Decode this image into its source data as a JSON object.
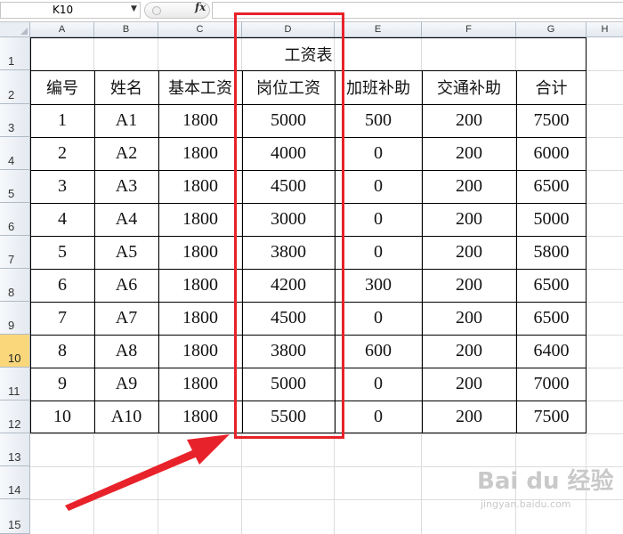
{
  "formula_bar": {
    "name_box": "K10",
    "fx_label": "fx",
    "formula": ""
  },
  "columns": [
    "A",
    "B",
    "C",
    "D",
    "E",
    "F",
    "G",
    "H"
  ],
  "rows": [
    "1",
    "2",
    "3",
    "4",
    "5",
    "6",
    "7",
    "8",
    "9",
    "10",
    "11",
    "12",
    "13",
    "14",
    "15"
  ],
  "active_row": "10",
  "table": {
    "title": "工资表",
    "headers": [
      "编号",
      "姓名",
      "基本工资",
      "岗位工资",
      "加班补助",
      "交通补助",
      "合计"
    ],
    "rows": [
      [
        "1",
        "A1",
        "1800",
        "5000",
        "500",
        "200",
        "7500"
      ],
      [
        "2",
        "A2",
        "1800",
        "4000",
        "0",
        "200",
        "6000"
      ],
      [
        "3",
        "A3",
        "1800",
        "4500",
        "0",
        "200",
        "6500"
      ],
      [
        "4",
        "A4",
        "1800",
        "3000",
        "0",
        "200",
        "5000"
      ],
      [
        "5",
        "A5",
        "1800",
        "3800",
        "0",
        "200",
        "5800"
      ],
      [
        "6",
        "A6",
        "1800",
        "4200",
        "300",
        "200",
        "6500"
      ],
      [
        "7",
        "A7",
        "1800",
        "4500",
        "0",
        "200",
        "6500"
      ],
      [
        "8",
        "A8",
        "1800",
        "3800",
        "600",
        "200",
        "6400"
      ],
      [
        "9",
        "A9",
        "1800",
        "5000",
        "0",
        "200",
        "7000"
      ],
      [
        "10",
        "A10",
        "1800",
        "5500",
        "0",
        "200",
        "7500"
      ]
    ]
  },
  "annotation": {
    "highlight_color": "#e8222a"
  },
  "watermark": {
    "logo": "Bai du 经验",
    "url": "jingyan.baidu.com"
  }
}
